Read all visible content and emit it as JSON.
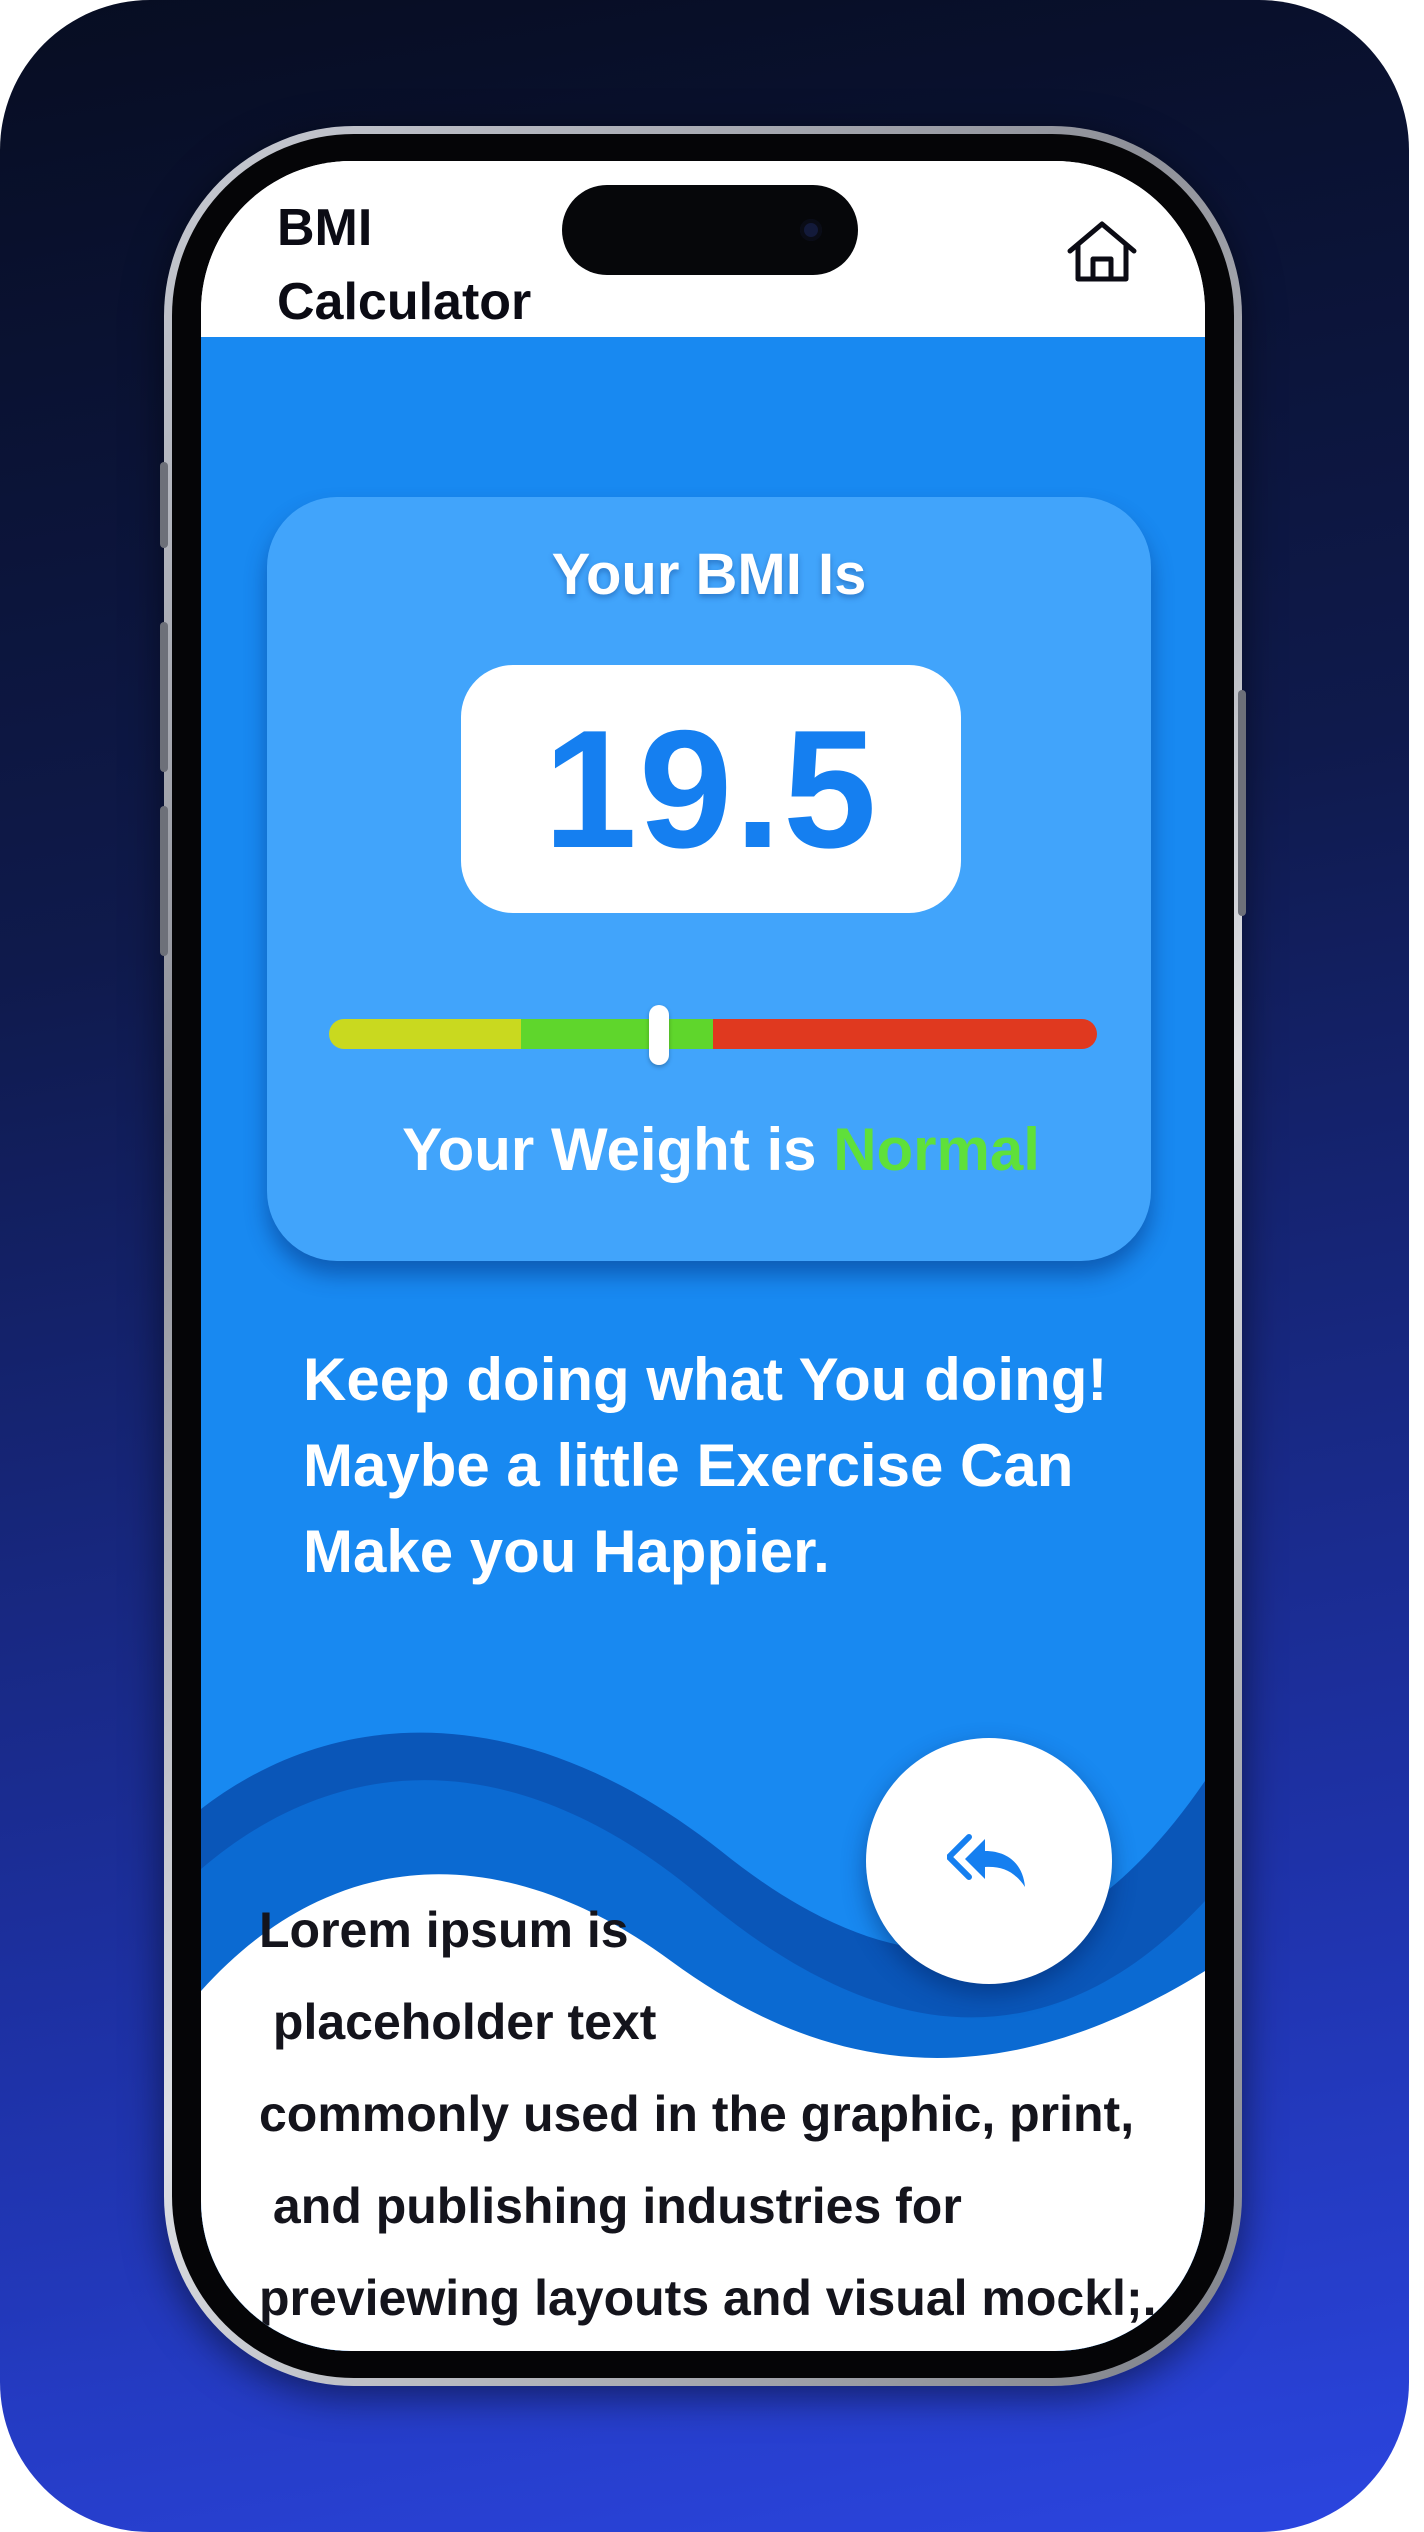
{
  "header": {
    "title": "BMI\nCalculator",
    "home_icon": "home-icon"
  },
  "result": {
    "heading": "Your BMI Is",
    "bmi_value": "19.5",
    "scale": {
      "segments": [
        {
          "name": "underweight",
          "color": "#c9d91f",
          "fraction": 0.25
        },
        {
          "name": "normal",
          "color": "#5fd62c",
          "fraction": 0.25
        },
        {
          "name": "overweight",
          "color": "#e0391f",
          "fraction": 0.5
        }
      ],
      "marker_fraction": 0.43
    },
    "weight_prefix": "Your Weight is ",
    "weight_status": "Normal",
    "status_color": "#5fe03a"
  },
  "advice": "Keep doing what You doing!\nMaybe a little Exercise Can\nMake you Happier.",
  "footer": {
    "lorem": "Lorem ipsum is\n placeholder text\ncommonly used in the graphic, print,\n and publishing industries for\npreviewing layouts and visual mockl;.",
    "back_button_icon": "reply-all-icon"
  },
  "colors": {
    "accent_blue": "#1889f1",
    "card_blue": "#41a4fb",
    "value_blue": "#157ff0"
  }
}
